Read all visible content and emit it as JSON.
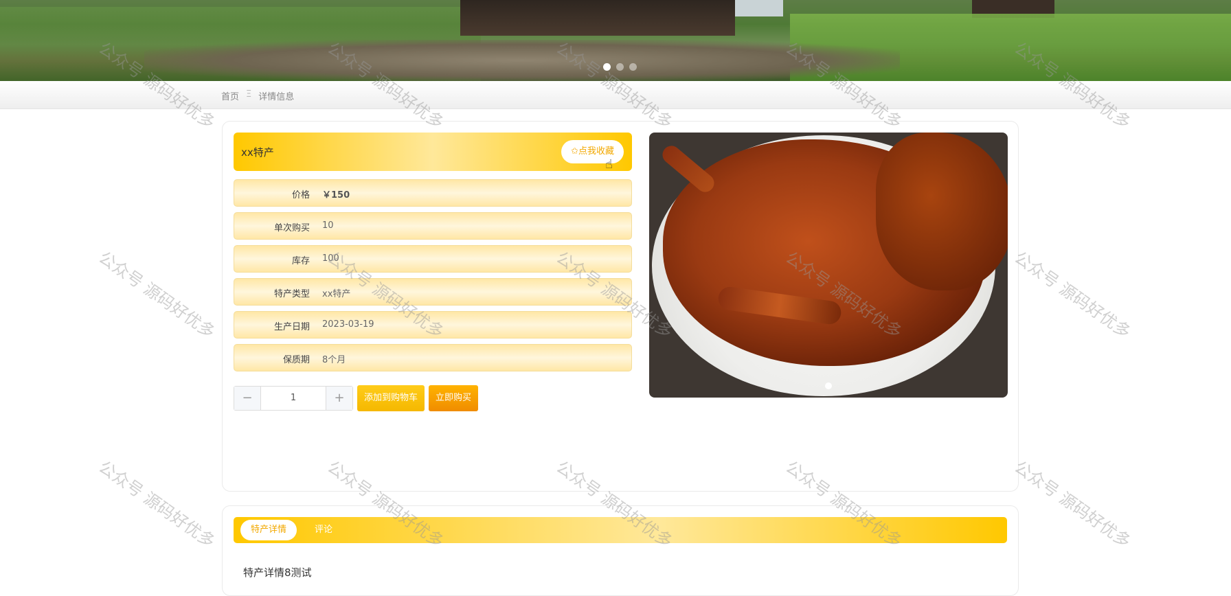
{
  "banner": {
    "slide_count": 3,
    "active_slide": 1
  },
  "breadcrumb": {
    "home": "首页",
    "separator": "Ξ",
    "current": "详情信息"
  },
  "product": {
    "name": "xx特产",
    "favorite_label": "✩点我收藏",
    "fields": [
      {
        "label": "价格",
        "value": "￥150"
      },
      {
        "label": "单次购买",
        "value": "10"
      },
      {
        "label": "库存",
        "value": "100"
      },
      {
        "label": "特产类型",
        "value": "xx特产"
      },
      {
        "label": "生产日期",
        "value": "2023-03-19"
      },
      {
        "label": "保质期",
        "value": "8个月"
      }
    ],
    "quantity": "1",
    "minus": "−",
    "plus": "+",
    "add_to_cart": "添加到购物车",
    "buy_now": "立即购买",
    "image_alt": "roast-duck-photo"
  },
  "tabs": [
    {
      "label": "特产详情",
      "active": true
    },
    {
      "label": "评论",
      "active": false
    }
  ],
  "detail_text": "特产详情8测试",
  "watermark": "公众号 源码好优多",
  "colors": {
    "accent": "#ffc800",
    "accent_text": "#f2a800",
    "buy": "#f08c00"
  }
}
